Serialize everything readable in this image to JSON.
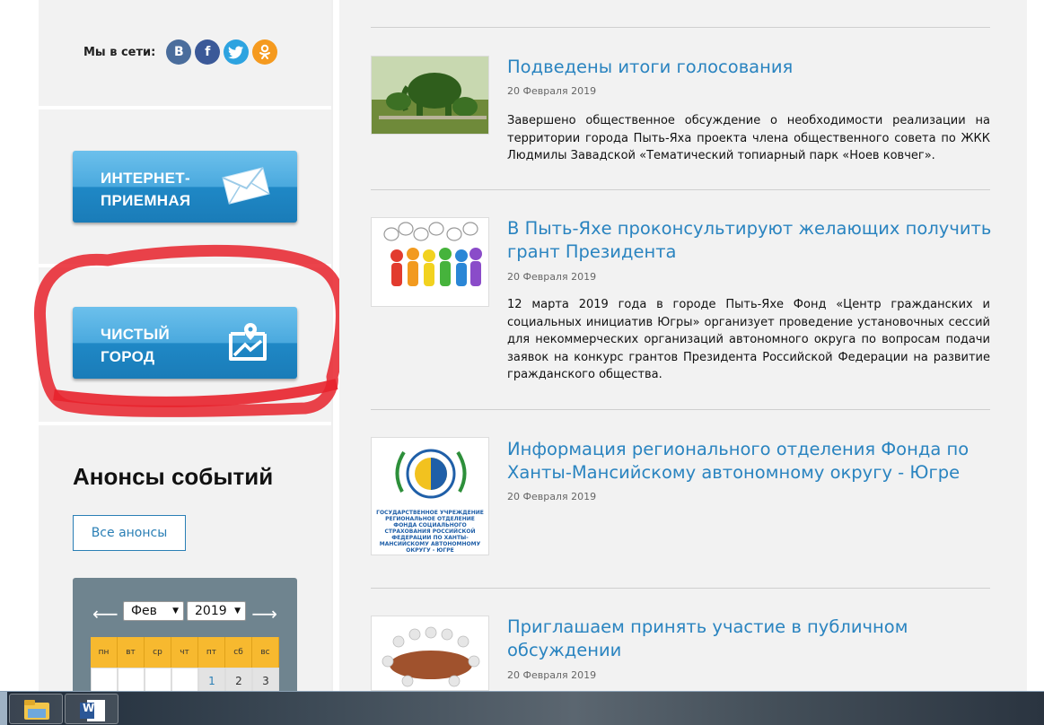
{
  "social": {
    "label": "Мы в сети:",
    "icons": [
      "vk-icon",
      "facebook-icon",
      "twitter-icon",
      "odnoklassniki-icon"
    ],
    "vk_glyph": "B",
    "fb_glyph": "f",
    "tw_glyph": "t",
    "ok_glyph": "ok"
  },
  "buttons": {
    "internet": {
      "line1": "ИНТЕРНЕТ-",
      "line2": "ПРИЕМНАЯ",
      "icon": "envelope-icon"
    },
    "clean_city": {
      "line1": "ЧИСТЫЙ",
      "line2": "ГОРОД",
      "icon": "map-pin-icon"
    }
  },
  "events": {
    "title": "Анонсы событий",
    "all_button": "Все анонсы"
  },
  "calendar": {
    "prev": "⟵",
    "next": "⟶",
    "month": "Фев",
    "year": "2019",
    "weekdays": [
      "пн",
      "вт",
      "ср",
      "чт",
      "пт",
      "сб",
      "вс"
    ],
    "first_row": [
      "",
      "",
      "",
      "",
      "1",
      "2",
      "3"
    ]
  },
  "news": [
    {
      "title": "Подведены итоги голосования",
      "date": "20 Февраля 2019",
      "text": "Завершено общественное обсуждение о необходимости реализации на территории города Пыть-Яха проекта члена общественного совета по ЖКК Людмилы Завадской «Тематический топиарный парк «Ноев ковчег»."
    },
    {
      "title": "В Пыть-Яхе проконсультируют желающих получить грант Президента",
      "date": "20 Февраля 2019",
      "text": "12 марта 2019 года в городе Пыть-Яхе Фонд «Центр гражданских и социальных инициатив Югры» организует проведение установочных сессий для некоммерческих организаций автономного округа по вопросам подачи заявок на конкурс грантов Президента Российской Федерации на развитие гражданского общества."
    },
    {
      "title": "Информация регионального отделения Фонда по Ханты-Мансийскому автономному округу - Югре",
      "date": "20 Февраля 2019",
      "text": "",
      "thumb_text": "ГОСУДАРСТВЕННОЕ УЧРЕЖДЕНИЕ РЕГИОНАЛЬНОЕ ОТДЕЛЕНИЕ ФОНДА СОЦИАЛЬНОГО СТРАХОВАНИЯ РОССИЙСКОЙ ФЕДЕРАЦИИ ПО ХАНТЫ-МАНСИЙСКОМУ АВТОНОМНОМУ ОКРУГУ - ЮГРЕ"
    },
    {
      "title": "Приглашаем принять участие в публичном обсуждении",
      "date": "20 Февраля 2019",
      "text": ""
    }
  ],
  "taskbar": {
    "items": [
      "file-explorer-icon",
      "word-icon"
    ],
    "word_glyph": "W"
  },
  "colors": {
    "link": "#2a84c0",
    "button": "#1f88c6",
    "accent_yellow": "#f7b92f",
    "annotation_red": "#e8222c"
  }
}
